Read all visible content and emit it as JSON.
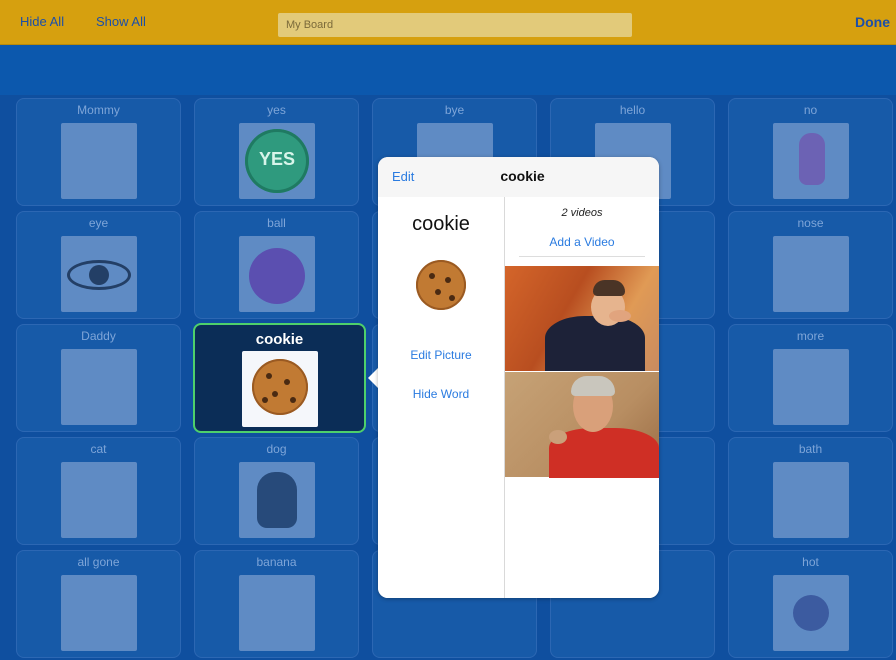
{
  "topbar": {
    "hide_all": "Hide All",
    "show_all": "Show All",
    "board_name": "My Board",
    "done": "Done"
  },
  "grid": {
    "rows": [
      [
        {
          "label": "Mommy"
        },
        {
          "label": "yes"
        },
        {
          "label": "bye"
        },
        {
          "label": "hello"
        },
        {
          "label": "no"
        }
      ],
      [
        {
          "label": "eye"
        },
        {
          "label": "ball"
        },
        {
          "label": ""
        },
        {
          "label": ""
        },
        {
          "label": "nose"
        }
      ],
      [
        {
          "label": "Daddy"
        },
        {
          "label": "cookie",
          "selected": true
        },
        {
          "label": ""
        },
        {
          "label": ""
        },
        {
          "label": "more"
        }
      ],
      [
        {
          "label": "cat"
        },
        {
          "label": "dog"
        },
        {
          "label": ""
        },
        {
          "label": ""
        },
        {
          "label": "bath"
        }
      ],
      [
        {
          "label": "all gone"
        },
        {
          "label": "banana"
        },
        {
          "label": ""
        },
        {
          "label": ""
        },
        {
          "label": "hot"
        }
      ]
    ],
    "yes_text": "YES"
  },
  "popover": {
    "edit": "Edit",
    "title": "cookie",
    "word": "cookie",
    "edit_picture": "Edit Picture",
    "hide_word": "Hide Word",
    "video_count": "2 videos",
    "add_video": "Add a Video"
  },
  "colors": {
    "topbar": "#d6a00f",
    "background": "#0a4a9c",
    "link": "#2a7be0",
    "selected_border": "#4ed06b"
  }
}
